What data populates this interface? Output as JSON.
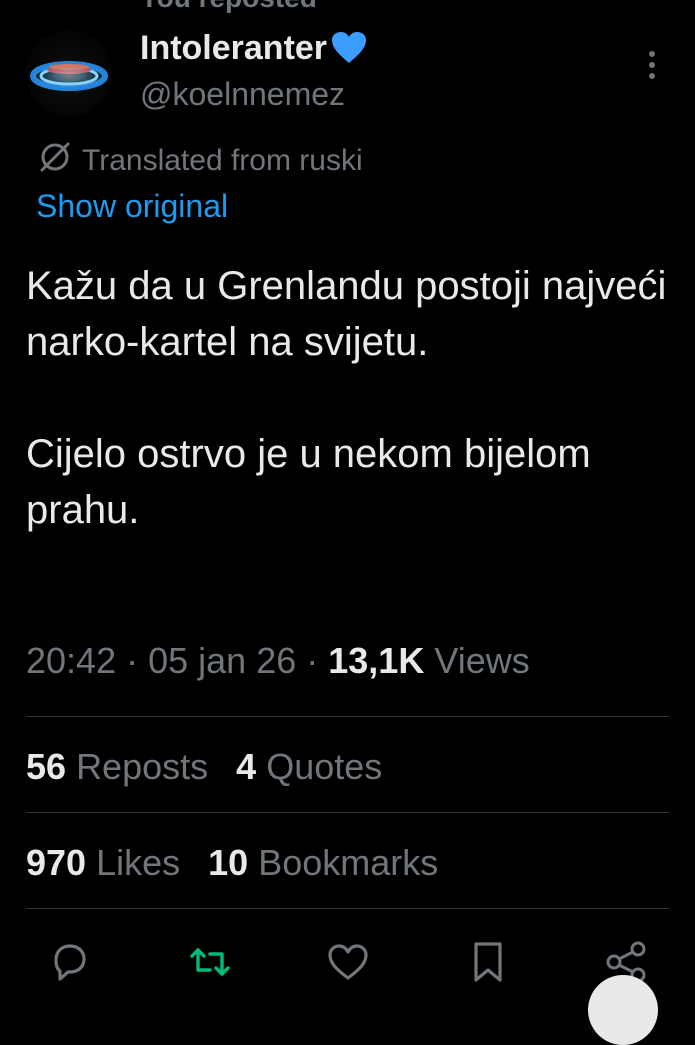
{
  "reposted_bar": "You reposted",
  "author": {
    "display_name": "Intoleranter",
    "handle": "@koelnnemez"
  },
  "translation": {
    "translated_label": "Translated from ruski",
    "show_original_label": "Show original"
  },
  "tweet": {
    "paragraph_1": "Kažu da u Grenlandu postoji najveći narko-kartel na svijetu.",
    "paragraph_2": "Cijelo ostrvo je u nekom bijelom prahu."
  },
  "meta": {
    "time": "20:42",
    "date": "05 jan 26",
    "views_count": "13,1K",
    "views_label": "Views"
  },
  "stats": {
    "reposts_count": "56",
    "reposts_label": "Reposts",
    "quotes_count": "4",
    "quotes_label": "Quotes",
    "likes_count": "970",
    "likes_label": "Likes",
    "bookmarks_count": "10",
    "bookmarks_label": "Bookmarks"
  },
  "icons": {
    "verified_heart": "blue-heart-icon",
    "more": "more-vertical-icon",
    "translate": "translate-icon",
    "reply": "reply-icon",
    "repost": "repost-icon",
    "like": "like-icon",
    "bookmark": "bookmark-icon",
    "share": "share-icon"
  },
  "colors": {
    "background": "#000000",
    "text_primary": "#e7e9ea",
    "text_secondary": "#71767b",
    "link": "#1d9bf0",
    "repost_active": "#00ba7c",
    "divider": "#2f3336"
  }
}
